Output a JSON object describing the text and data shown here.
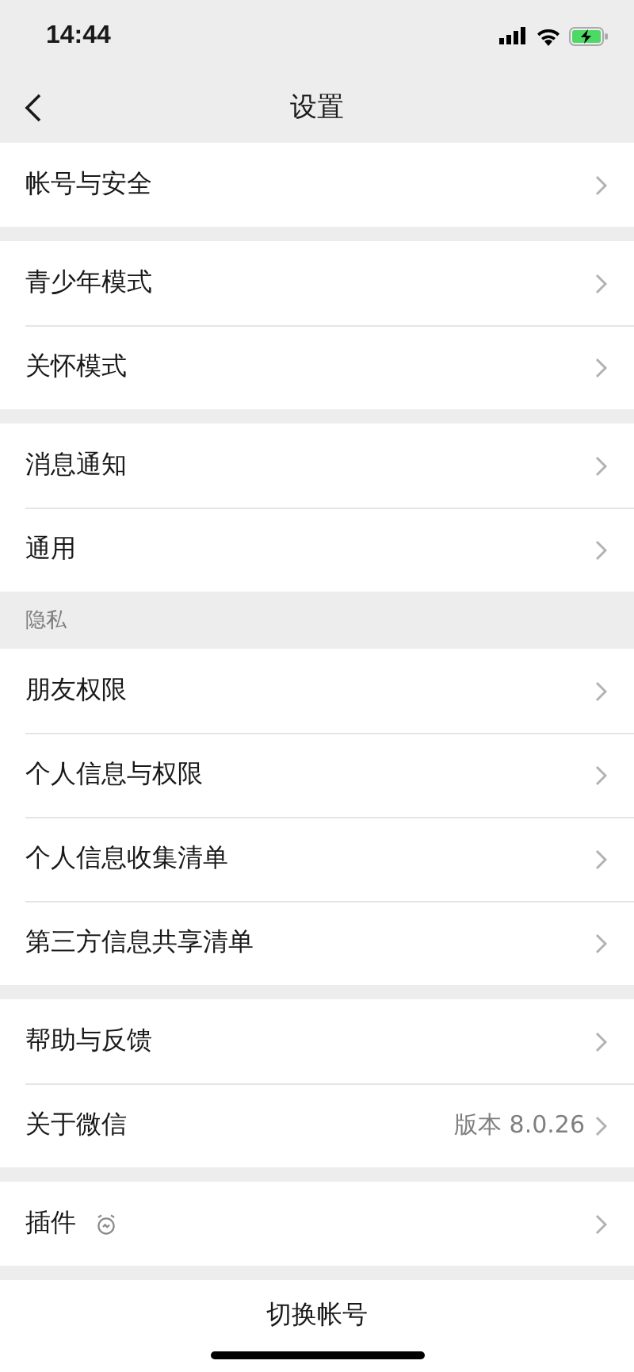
{
  "status_bar": {
    "time": "14:44"
  },
  "nav": {
    "title": "设置"
  },
  "sections": [
    {
      "rows": [
        {
          "label": "帐号与安全"
        }
      ]
    },
    {
      "rows": [
        {
          "label": "青少年模式"
        },
        {
          "label": "关怀模式"
        }
      ]
    },
    {
      "rows": [
        {
          "label": "消息通知"
        },
        {
          "label": "通用"
        }
      ]
    },
    {
      "header": "隐私",
      "rows": [
        {
          "label": "朋友权限"
        },
        {
          "label": "个人信息与权限"
        },
        {
          "label": "个人信息收集清单"
        },
        {
          "label": "第三方信息共享清单"
        }
      ]
    },
    {
      "rows": [
        {
          "label": "帮助与反馈"
        },
        {
          "label": "关于微信",
          "value": "版本 8.0.26"
        }
      ]
    },
    {
      "rows": [
        {
          "label": "插件",
          "kind": "with_icon"
        }
      ]
    }
  ],
  "footer": {
    "label": "切换帐号"
  }
}
